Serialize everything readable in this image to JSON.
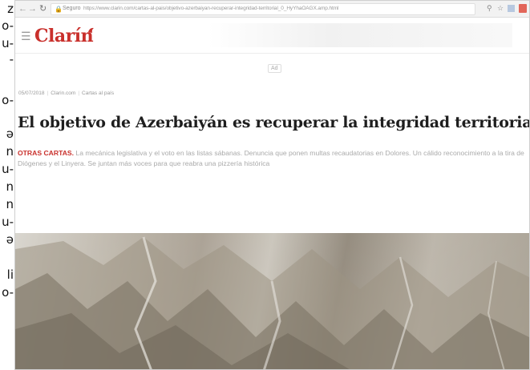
{
  "page_edge_text": [
    "z",
    "o-",
    "u-",
    "-",
    "o-",
    "ə",
    "n",
    "u-",
    "n",
    "n",
    "u-",
    "ə",
    "li",
    "o-"
  ],
  "browser": {
    "secure_label": "Seguro",
    "url": "https://www.clarin.com/cartas-al-pais/objetivo-azerbaiyan-recuperar-integridad-territorial_0_HyYhaOAGX.amp.html"
  },
  "site": {
    "logo": "Clarín"
  },
  "ad": {
    "label": "Ad"
  },
  "meta": {
    "date": "05/07/2018",
    "source": "Clarin.com",
    "section": "Cartas al país"
  },
  "article": {
    "headline": "El objetivo de Azerbaiyán es recuperar la integridad territorial",
    "kicker": "OTRAS CARTAS.",
    "subtitle": "La mecánica legislativa y el voto en las listas sábanas. Denuncia que ponen multas recaudatorias en Dolores. Un cálido reconocimiento a la tira de Diógenes y el Linyera. Se juntan más voces para que reabra una pizzería histórica"
  },
  "colors": {
    "brand": "#c9302c",
    "headline": "#1e1e1e",
    "muted": "#aaaaaa"
  },
  "icons": [
    "back-icon",
    "forward-icon",
    "reload-icon",
    "lock-icon",
    "zoom-icon",
    "star-icon",
    "extension-icon",
    "hamburger-icon"
  ]
}
